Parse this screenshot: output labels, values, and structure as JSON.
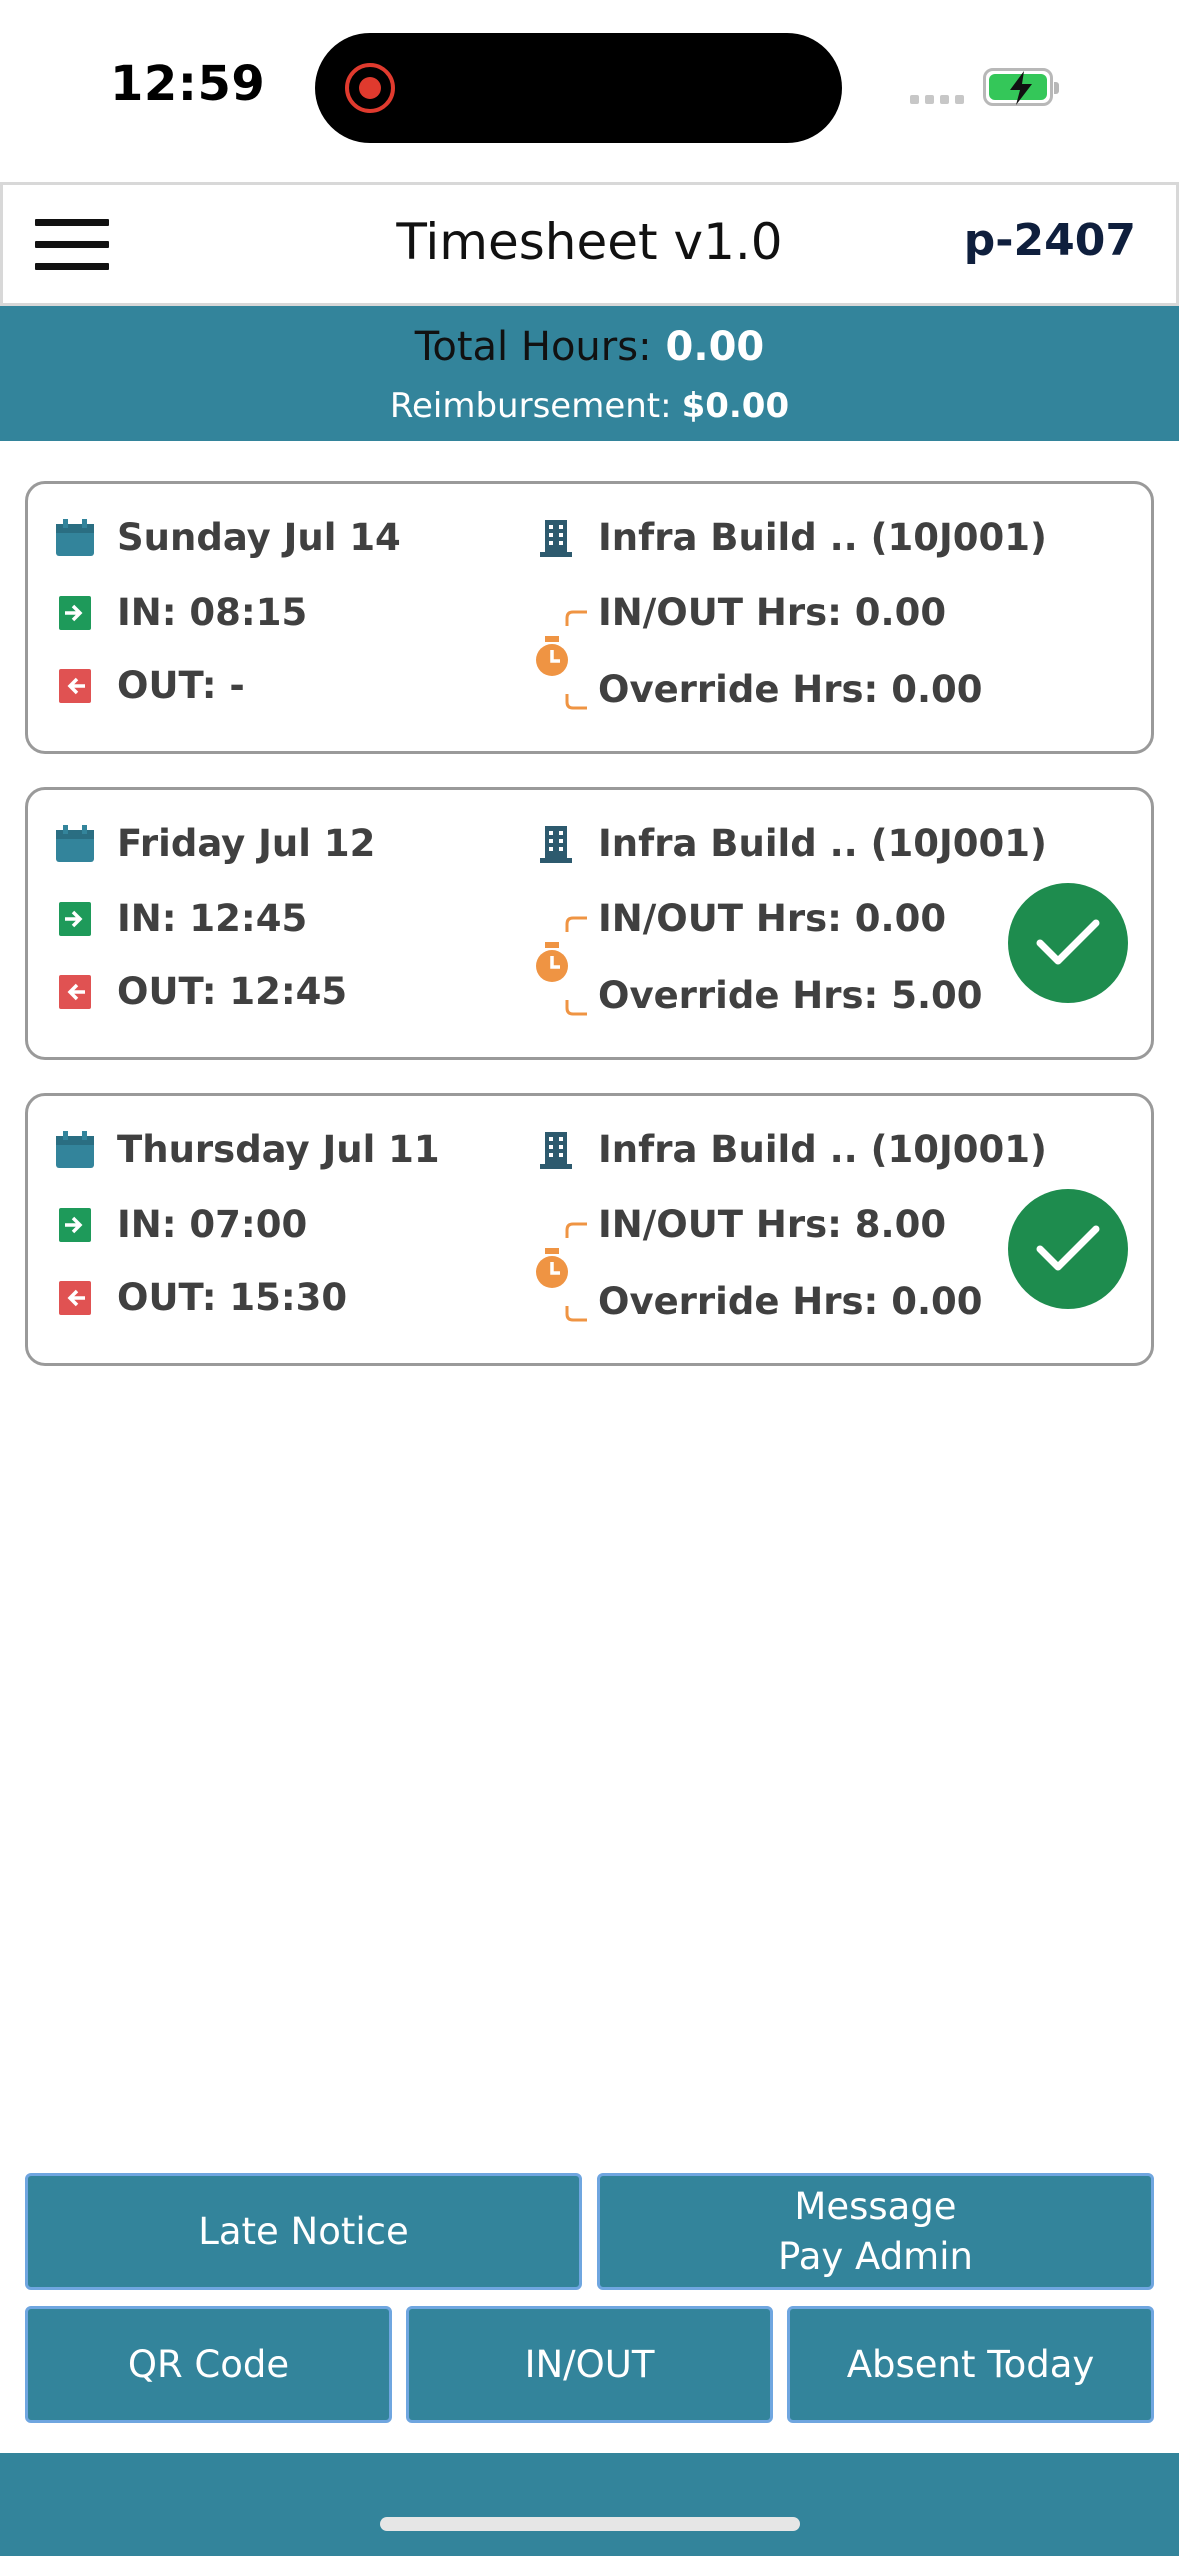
{
  "status_bar": {
    "time": "12:59"
  },
  "header": {
    "title": "Timesheet v1.0",
    "user_id": "p-2407"
  },
  "totals": {
    "total_hours_label": "Total Hours:",
    "total_hours_value": "0.00",
    "reimbursement_label": "Reimbursement:",
    "reimbursement_value": "$0.00"
  },
  "entries": [
    {
      "date": "Sunday Jul 14",
      "job": "Infra Build .. (10J001)",
      "in": "IN: 08:15",
      "out": "OUT: -",
      "inout_hrs": "IN/OUT Hrs: 0.00",
      "override_hrs": "Override Hrs: 0.00",
      "approved": false
    },
    {
      "date": "Friday Jul 12",
      "job": "Infra Build .. (10J001)",
      "in": "IN: 12:45",
      "out": "OUT: 12:45",
      "inout_hrs": "IN/OUT Hrs: 0.00",
      "override_hrs": "Override Hrs: 5.00",
      "approved": true
    },
    {
      "date": "Thursday Jul 11",
      "job": "Infra Build .. (10J001)",
      "in": "IN: 07:00",
      "out": "OUT: 15:30",
      "inout_hrs": "IN/OUT Hrs: 8.00",
      "override_hrs": "Override Hrs: 0.00",
      "approved": true
    }
  ],
  "actions": {
    "late_notice": "Late Notice",
    "message_line1": "Message",
    "message_line2": "Pay Admin",
    "qr_code": "QR Code",
    "in_out": "IN/OUT",
    "absent_today": "Absent Today"
  },
  "colors": {
    "primary": "#33849b",
    "approved": "#1e8c4e",
    "in_icon": "#1e9a5a",
    "out_icon": "#e05252",
    "timer_icon": "#ef9443"
  },
  "icons": [
    "calendar-icon",
    "building-icon",
    "sign-in-icon",
    "sign-out-icon",
    "timer-icon",
    "checkmark-icon",
    "menu-icon"
  ]
}
